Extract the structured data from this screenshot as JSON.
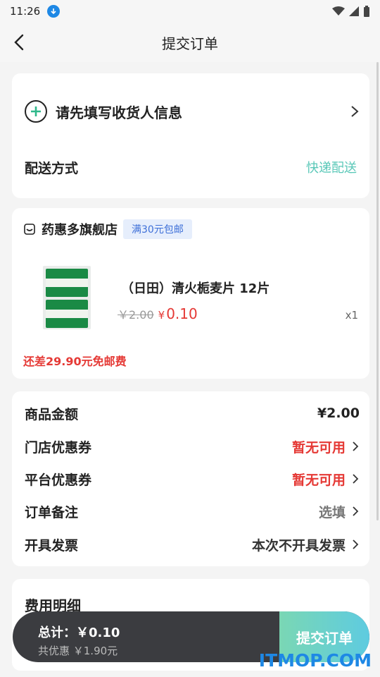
{
  "status_bar": {
    "time": "11:26"
  },
  "nav": {
    "title": "提交订单"
  },
  "address": {
    "prompt": "请先填写收货人信息"
  },
  "delivery": {
    "label": "配送方式",
    "value": "快递配送"
  },
  "store": {
    "name": "药惠多旗舰店",
    "badge": "满30元包邮",
    "product": {
      "name": "（日田）清火栀麦片 12片",
      "original_price": "￥2.00",
      "currency": "¥",
      "price": "0.10",
      "quantity": "x1"
    },
    "shipping_note": "还差29.90元免邮费"
  },
  "summary": {
    "rows": [
      {
        "label": "商品金额",
        "value": "¥2.00"
      },
      {
        "label": "门店优惠券",
        "value": "暂无可用"
      },
      {
        "label": "平台优惠券",
        "value": "暂无可用"
      },
      {
        "label": "订单备注",
        "value": "选填"
      },
      {
        "label": "开具发票",
        "value": "本次不开具发票"
      }
    ]
  },
  "fee": {
    "title": "费用明细"
  },
  "bottom": {
    "total": "总计：￥0.10",
    "discount": "共优惠 ￥1.90元",
    "submit_label": "提交订单"
  },
  "watermark": "ITMOP.COM",
  "colors": {
    "accent_green": "#5ac8b8",
    "price_red": "#e53935",
    "badge_blue": "#3d6fd8"
  }
}
